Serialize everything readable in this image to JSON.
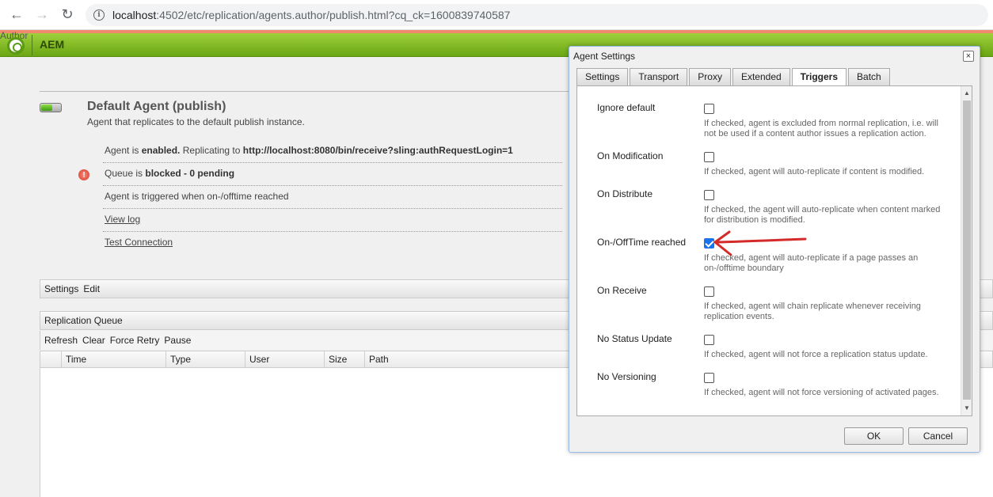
{
  "browser": {
    "back_icon": "arrow-left-icon",
    "forward_icon": "arrow-right-icon",
    "reload_icon": "reload-icon",
    "url_host": "localhost",
    "url_rest": ":4502/etc/replication/agents.author/publish.html?cq_ck=1600839740587"
  },
  "aem": {
    "mode_label": "Author",
    "title": "AEM"
  },
  "agent": {
    "title": "Default Agent (publish)",
    "description": "Agent that replicates to the default publish instance.",
    "status_prefix": "Agent is ",
    "status_enabled": "enabled.",
    "status_mid": " Replicating to ",
    "status_url": "http://localhost:8080/bin/receive?sling:authRequestLogin=1",
    "queue_prefix": "Queue is ",
    "queue_state": "blocked - 0 pending",
    "trigger_text": "Agent is triggered when on-/offtime reached",
    "view_log": "View log",
    "test_connection": "Test Connection"
  },
  "settings_bar": {
    "settings": "Settings",
    "edit": "Edit"
  },
  "queue": {
    "title": "Replication Queue",
    "actions": [
      "Refresh",
      "Clear",
      "Force Retry",
      "Pause"
    ],
    "columns": [
      "Time",
      "Type",
      "User",
      "Size",
      "Path"
    ]
  },
  "dialog": {
    "title": "Agent Settings",
    "close": "×",
    "tabs": [
      "Settings",
      "Transport",
      "Proxy",
      "Extended",
      "Triggers",
      "Batch"
    ],
    "active_tab": "Triggers",
    "fields": [
      {
        "label": "Ignore default",
        "checked": false,
        "hint": "If checked, agent is excluded from normal replication, i.e. will not be used if a content author issues a replication action."
      },
      {
        "label": "On Modification",
        "checked": false,
        "hint": "If checked, agent will auto-replicate if content is modified."
      },
      {
        "label": "On Distribute",
        "checked": false,
        "hint": "If checked, the agent will auto-replicate when content marked for distribution is modified."
      },
      {
        "label": "On-/OffTime reached",
        "checked": true,
        "hint": "If checked, agent will auto-replicate if a page passes an on-/offtime boundary"
      },
      {
        "label": "On Receive",
        "checked": false,
        "hint": "If checked, agent will chain replicate whenever receiving replication events."
      },
      {
        "label": "No Status Update",
        "checked": false,
        "hint": "If checked, agent will not force a replication status update."
      },
      {
        "label": "No Versioning",
        "checked": false,
        "hint": "If checked, agent will not force versioning of activated pages."
      }
    ],
    "ok": "OK",
    "cancel": "Cancel"
  },
  "colors": {
    "aem_green": "#7ab51d",
    "accent_red": "#d42a2a",
    "checkbox_blue": "#1a73e8"
  }
}
